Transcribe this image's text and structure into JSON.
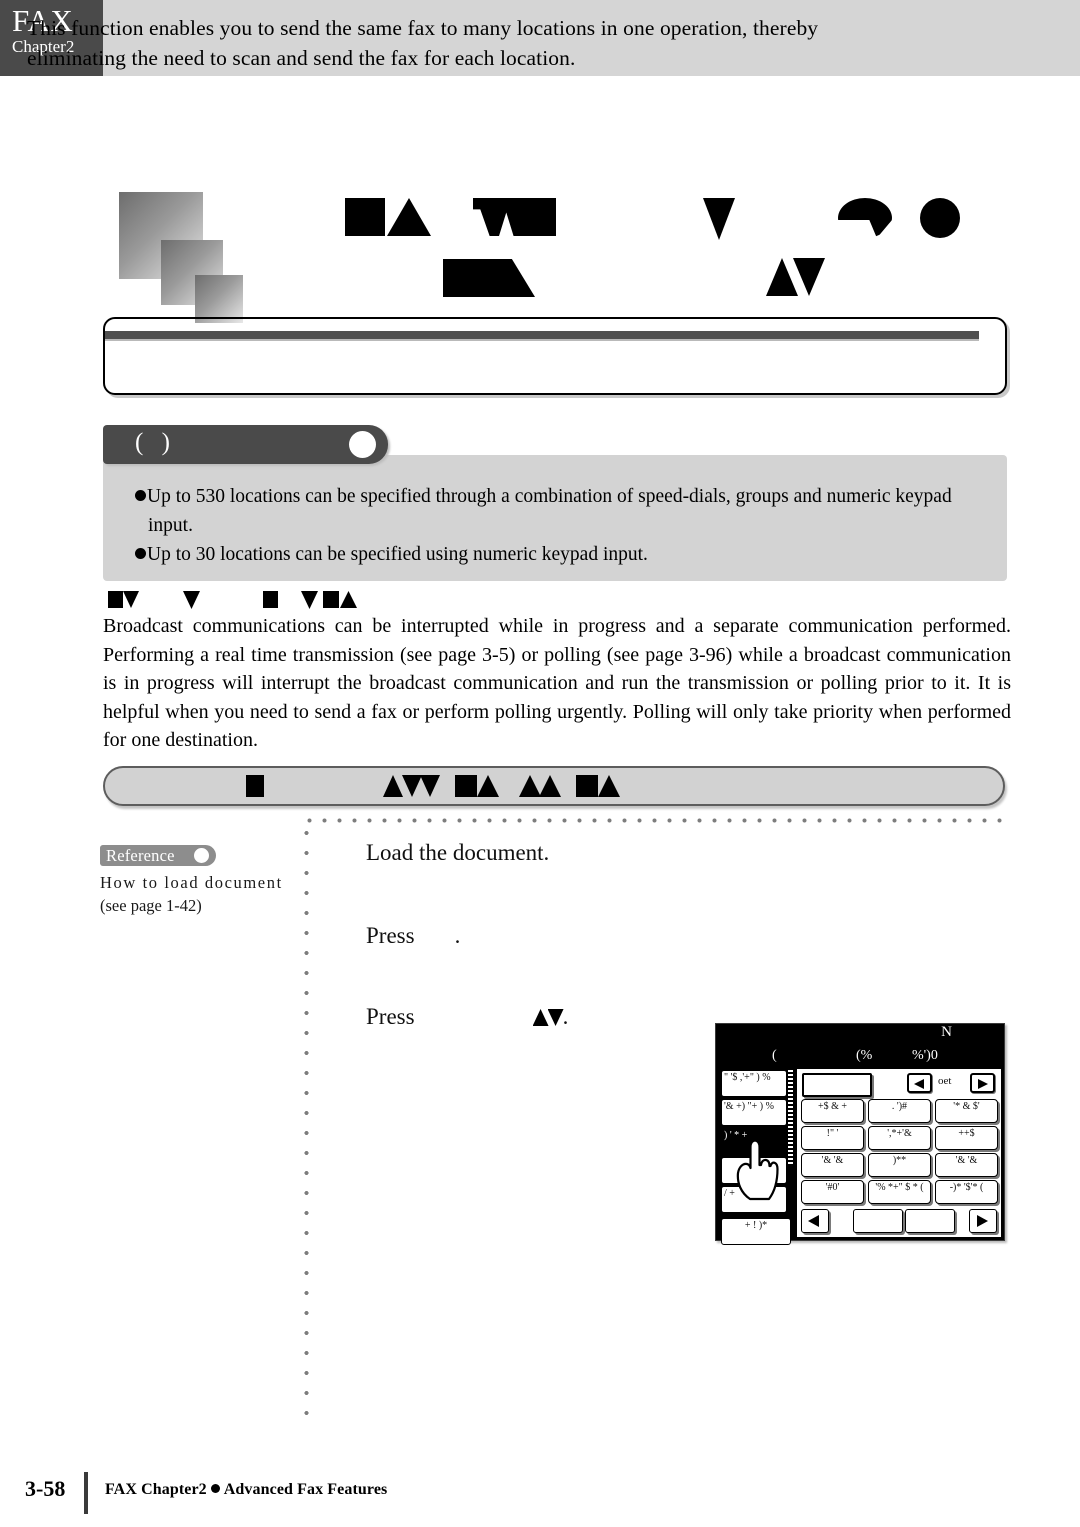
{
  "header": {
    "tab_title": "FAX",
    "tab_subtitle": "Chapter2"
  },
  "title": {
    "glyphs_note": "title rendered as solid black substitution glyphs (missing font)",
    "row1": [
      "block-square",
      "block-triangle-up",
      "block-w",
      "block-square",
      "block-triangle-down",
      "block-c",
      "block-ellipse"
    ],
    "row2": [
      "block-square",
      "block-slash",
      "block-triangle-up",
      "block-triangle-down"
    ]
  },
  "intro": {
    "text": "This function enables you to send the same fax to many locations in one operation, thereby eliminating the need to scan and send the fax for each location."
  },
  "note": {
    "tab_label": "(   )",
    "bullets": [
      "Up to 530 locations can be specified through a combination of speed-dials, groups and numeric keypad",
      "input.",
      "Up to 30 locations can be specified using numeric keypad input."
    ]
  },
  "section": {
    "heading_glyphs": [
      "block-square",
      "block-triangle-down",
      "block-triangle-down",
      "block-square",
      "block-triangle-down",
      "block-square",
      "block-triangle-up"
    ],
    "paragraph": "Broadcast communications can be interrupted while in progress and a separate communication performed. Performing a real time transmission (see page 3-5) or polling (see page 3-96) while a broadcast communication is in progress will interrupt the broadcast communication and run the transmission or polling prior to it. It is helpful when you need to send a fax or perform polling urgently. Polling will only take priority when performed for one destination."
  },
  "step_bar": {
    "glyphs": [
      "block-square",
      "block-triangle-up",
      "block-triangle-down",
      "block-triangle-down",
      "block-square",
      "block-triangle-up",
      "block-triangle-up",
      "block-triangle-up",
      "block-square",
      "block-triangle-up"
    ]
  },
  "reference": {
    "badge_label": "Reference",
    "line1": "How to load document",
    "line2": "(see page 1-42)"
  },
  "steps": [
    {
      "text": "Load the document.",
      "trailing_glyph": ""
    },
    {
      "prefix": "Press",
      "suffix": ".",
      "glyph": ""
    },
    {
      "prefix": "Press",
      "suffix": ".",
      "glyph": "block-triangle-pair"
    }
  ],
  "lcd": {
    "title": "N",
    "sub1": "(",
    "sub2": "(%",
    "sub3": "%')0",
    "left_tabs": [
      "\" '$ ,'+\" ) %",
      "'& +) \"+ ) %",
      ") ' * +",
      "",
      "/        +",
      "+ !  )*"
    ],
    "selected_tab_index": 2,
    "nav_label": "oet",
    "keys": [
      "+$  & +",
      ".   ')#",
      "'*   &   $'",
      "!\"   '",
      "',*+'&",
      "++$",
      "'&  '&",
      ")**",
      "'&   '&",
      "'#0'",
      "'%  *+\" $ *  (",
      "-)*  '$'*  ("
    ],
    "bottom_buttons": [
      "left-arrow",
      "blank",
      "blank",
      "right-arrow"
    ]
  },
  "footer": {
    "page_number": "3-58",
    "text_left": "FAX Chapter2",
    "text_right": "Advanced Fax Features"
  }
}
